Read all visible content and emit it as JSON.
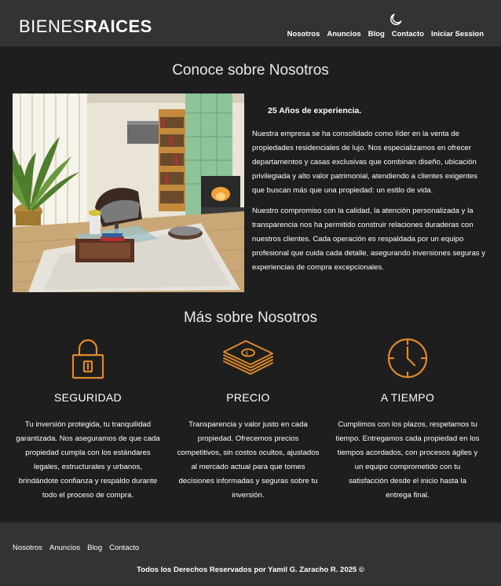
{
  "header": {
    "logo_light": "BIENES",
    "logo_bold": "RAICES",
    "nav": [
      "Nosotros",
      "Anuncios",
      "Blog",
      "Contacto",
      "Iniciar Session"
    ]
  },
  "about": {
    "title": "Conoce sobre Nosotros",
    "heading": "25 Años de experiencia.",
    "paragraphs": [
      "Nuestra empresa se ha consolidado como líder en la venta de propiedades residenciales de lujo. Nos especializamos en ofrecer departamentos y casas exclusivas que combinan diseño, ubicación privilegiada y alto valor patrimonial, atendiendo a clientes exigentes que buscan más que una propiedad: un estilo de vida.",
      "Nuestro compromiso con la calidad, la atención personalizada y la transparencia nos ha permitido construir relaciones duraderas con nuestros clientes. Cada operación es respaldada por un equipo profesional que cuida cada detalle, asegurando inversiones seguras y experiencias de compra excepcionales."
    ]
  },
  "features": {
    "title": "Más sobre Nosotros",
    "items": [
      {
        "title": "SEGURIDAD",
        "text": "Tu inversión protegida, tu tranquilidad garantizada. Nos aseguramos de que cada propiedad cumpla con los estándares legales, estructurales y urbanos, brindándote confianza y respaldo durante todo el proceso de compra."
      },
      {
        "title": "PRECIO",
        "text": "Transparencia y valor justo en cada propiedad. Ofrecemos precios competitivos, sin costos ocultos, ajustados al mercado actual para que tomes decisiones informadas y seguras sobre tu inversión."
      },
      {
        "title": "A TIEMPO",
        "text": "Cumplimos con los plazos, respetamos tu tiempo. Entregamos cada propiedad en los tiempos acordados, con procesos ágiles y un equipo comprometido con tu satisfacción desde el inicio hasta la entrega final."
      }
    ]
  },
  "footer": {
    "nav": [
      "Nosotros",
      "Anuncios",
      "Blog",
      "Contacto"
    ],
    "copyright": "Todos los Derechos Reservados por Yamil G. Zaracho R. 2025 ©"
  },
  "colors": {
    "accent": "#e08a2a",
    "header_bg": "#333333",
    "body_bg": "#1e1e1e"
  },
  "icons": [
    "moon-icon",
    "lock-icon",
    "money-icon",
    "clock-icon"
  ]
}
